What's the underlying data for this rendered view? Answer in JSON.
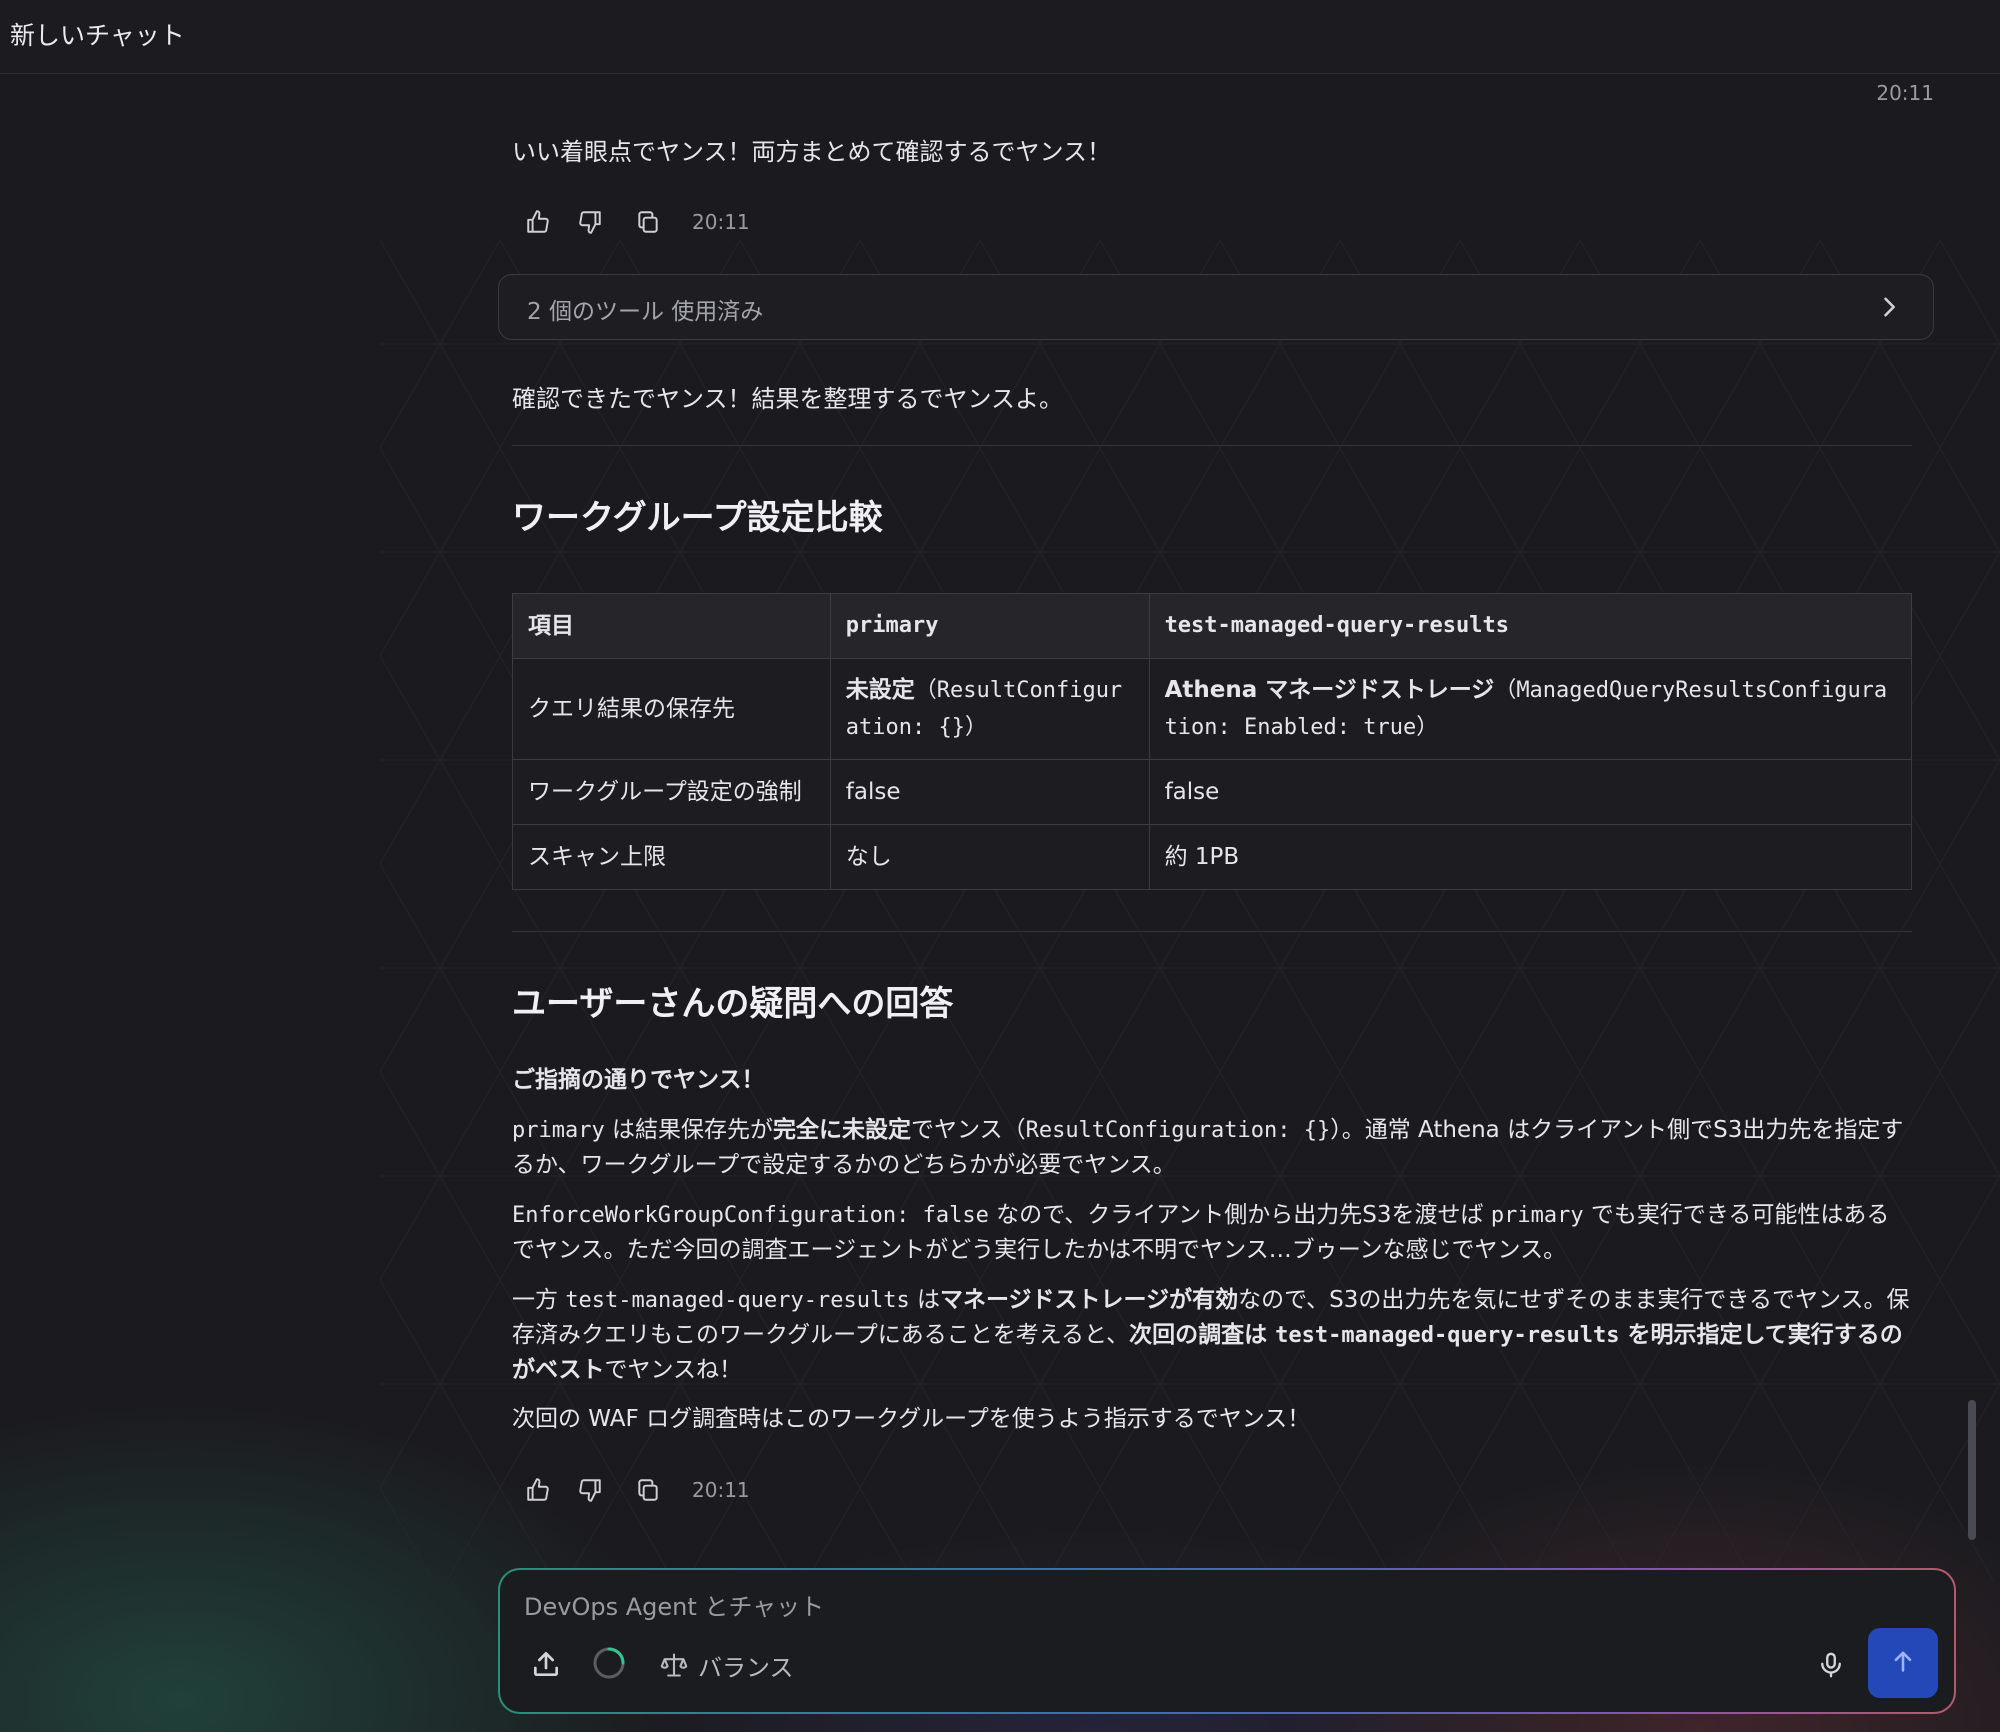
{
  "window": {
    "title": "新しいチャット"
  },
  "messages": {
    "top_timestamp": "20:11",
    "first": {
      "text": "いい着眼点でヤンス！両方まとめて確認するでヤンス！",
      "timestamp": "20:11"
    },
    "tools_used": {
      "label": "2 個のツール 使用済み"
    },
    "intro": "確認できたでヤンス！結果を整理するでヤンスよ。",
    "section1_title": "ワークグループ設定比較",
    "table": {
      "headers": [
        "項目",
        "primary",
        "test-managed-query-results"
      ],
      "rows": [
        {
          "item": "クエリ結果の保存先",
          "primary_bold": "未設定",
          "primary_code": "（ResultConfiguration: {}）",
          "test_bold": "Athena マネージドストレージ",
          "test_code": "（ManagedQueryResultsConfiguration: Enabled: true）"
        },
        {
          "item": "ワークグループ設定の強制",
          "primary": "false",
          "test": "false"
        },
        {
          "item": "スキャン上限",
          "primary": "なし",
          "test": "約 1PB"
        }
      ]
    },
    "section2_title": "ユーザーさんの疑問への回答",
    "answer": {
      "lead": "ご指摘の通りでヤンス！",
      "p1": {
        "code1": "primary",
        "t1": " は結果保存先が",
        "b1": "完全に未設定",
        "t2": "でヤンス（",
        "code2": "ResultConfiguration: {}",
        "t3": "）。通常 Athena はクライアント側でS3出力先を指定するか、ワークグループで設定するかのどちらかが必要でヤンス。"
      },
      "p2": {
        "code1": "EnforceWorkGroupConfiguration: false",
        "t1": " なので、クライアント側から出力先S3を渡せば ",
        "code2": "primary",
        "t2": " でも実行できる可能性はあるでヤンス。ただ今回の調査エージェントがどう実行したかは不明でヤンス…ブゥーンな感じでヤンス。"
      },
      "p3": {
        "t1": "一方 ",
        "code1": "test-managed-query-results",
        "t2": " は",
        "b1": "マネージドストレージが有効",
        "t3": "なので、S3の出力先を気にせずそのまま実行できるでヤンス。保存済みクエリもこのワークグループにあることを考えると、",
        "b2a": "次回の調査は ",
        "code2": "test-managed-query-results",
        "b2b": " を明示指定して実行するのがベスト",
        "t4": "でヤンスね！"
      },
      "p4": "次回の WAF ログ調査時はこのワークグループを使うよう指示するでヤンス！",
      "timestamp": "20:11"
    }
  },
  "composer": {
    "placeholder": "DevOps Agent とチャット",
    "mode_label": "バランス"
  },
  "icons": {
    "like": "thumbs-up-icon",
    "dislike": "thumbs-down-icon",
    "copy": "copy-icon",
    "chevron": "chevron-right-icon",
    "upload": "upload-icon",
    "balance": "scale-icon",
    "mic": "microphone-icon",
    "send": "arrow-up-icon"
  },
  "colors": {
    "background": "#1b1b1f",
    "send_button": "#2448b8",
    "border": "#3b3b42"
  }
}
